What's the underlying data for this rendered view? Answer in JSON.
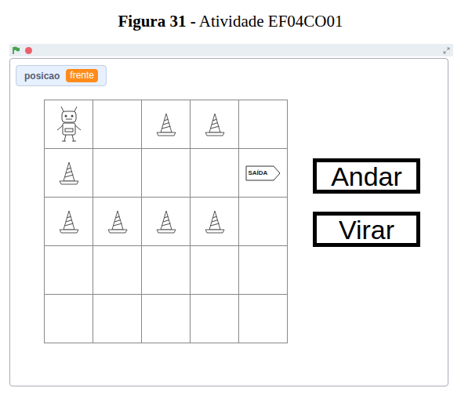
{
  "caption": {
    "label": "Figura 31 -",
    "text": "Atividade EF04CO01"
  },
  "monitor": {
    "name": "posicao",
    "value": "frente"
  },
  "grid": [
    [
      {
        "kind": "robot"
      },
      {
        "kind": "empty"
      },
      {
        "kind": "cone"
      },
      {
        "kind": "cone"
      },
      {
        "kind": "empty"
      }
    ],
    [
      {
        "kind": "cone"
      },
      {
        "kind": "empty"
      },
      {
        "kind": "empty"
      },
      {
        "kind": "empty"
      },
      {
        "kind": "exit",
        "text": "SAÍDA"
      }
    ],
    [
      {
        "kind": "cone"
      },
      {
        "kind": "cone"
      },
      {
        "kind": "cone"
      },
      {
        "kind": "cone"
      },
      {
        "kind": "empty"
      }
    ],
    [
      {
        "kind": "empty"
      },
      {
        "kind": "empty"
      },
      {
        "kind": "empty"
      },
      {
        "kind": "empty"
      },
      {
        "kind": "empty"
      }
    ],
    [
      {
        "kind": "empty"
      },
      {
        "kind": "empty"
      },
      {
        "kind": "empty"
      },
      {
        "kind": "empty"
      },
      {
        "kind": "empty"
      }
    ]
  ],
  "buttons": [
    "Andar",
    "Virar"
  ]
}
